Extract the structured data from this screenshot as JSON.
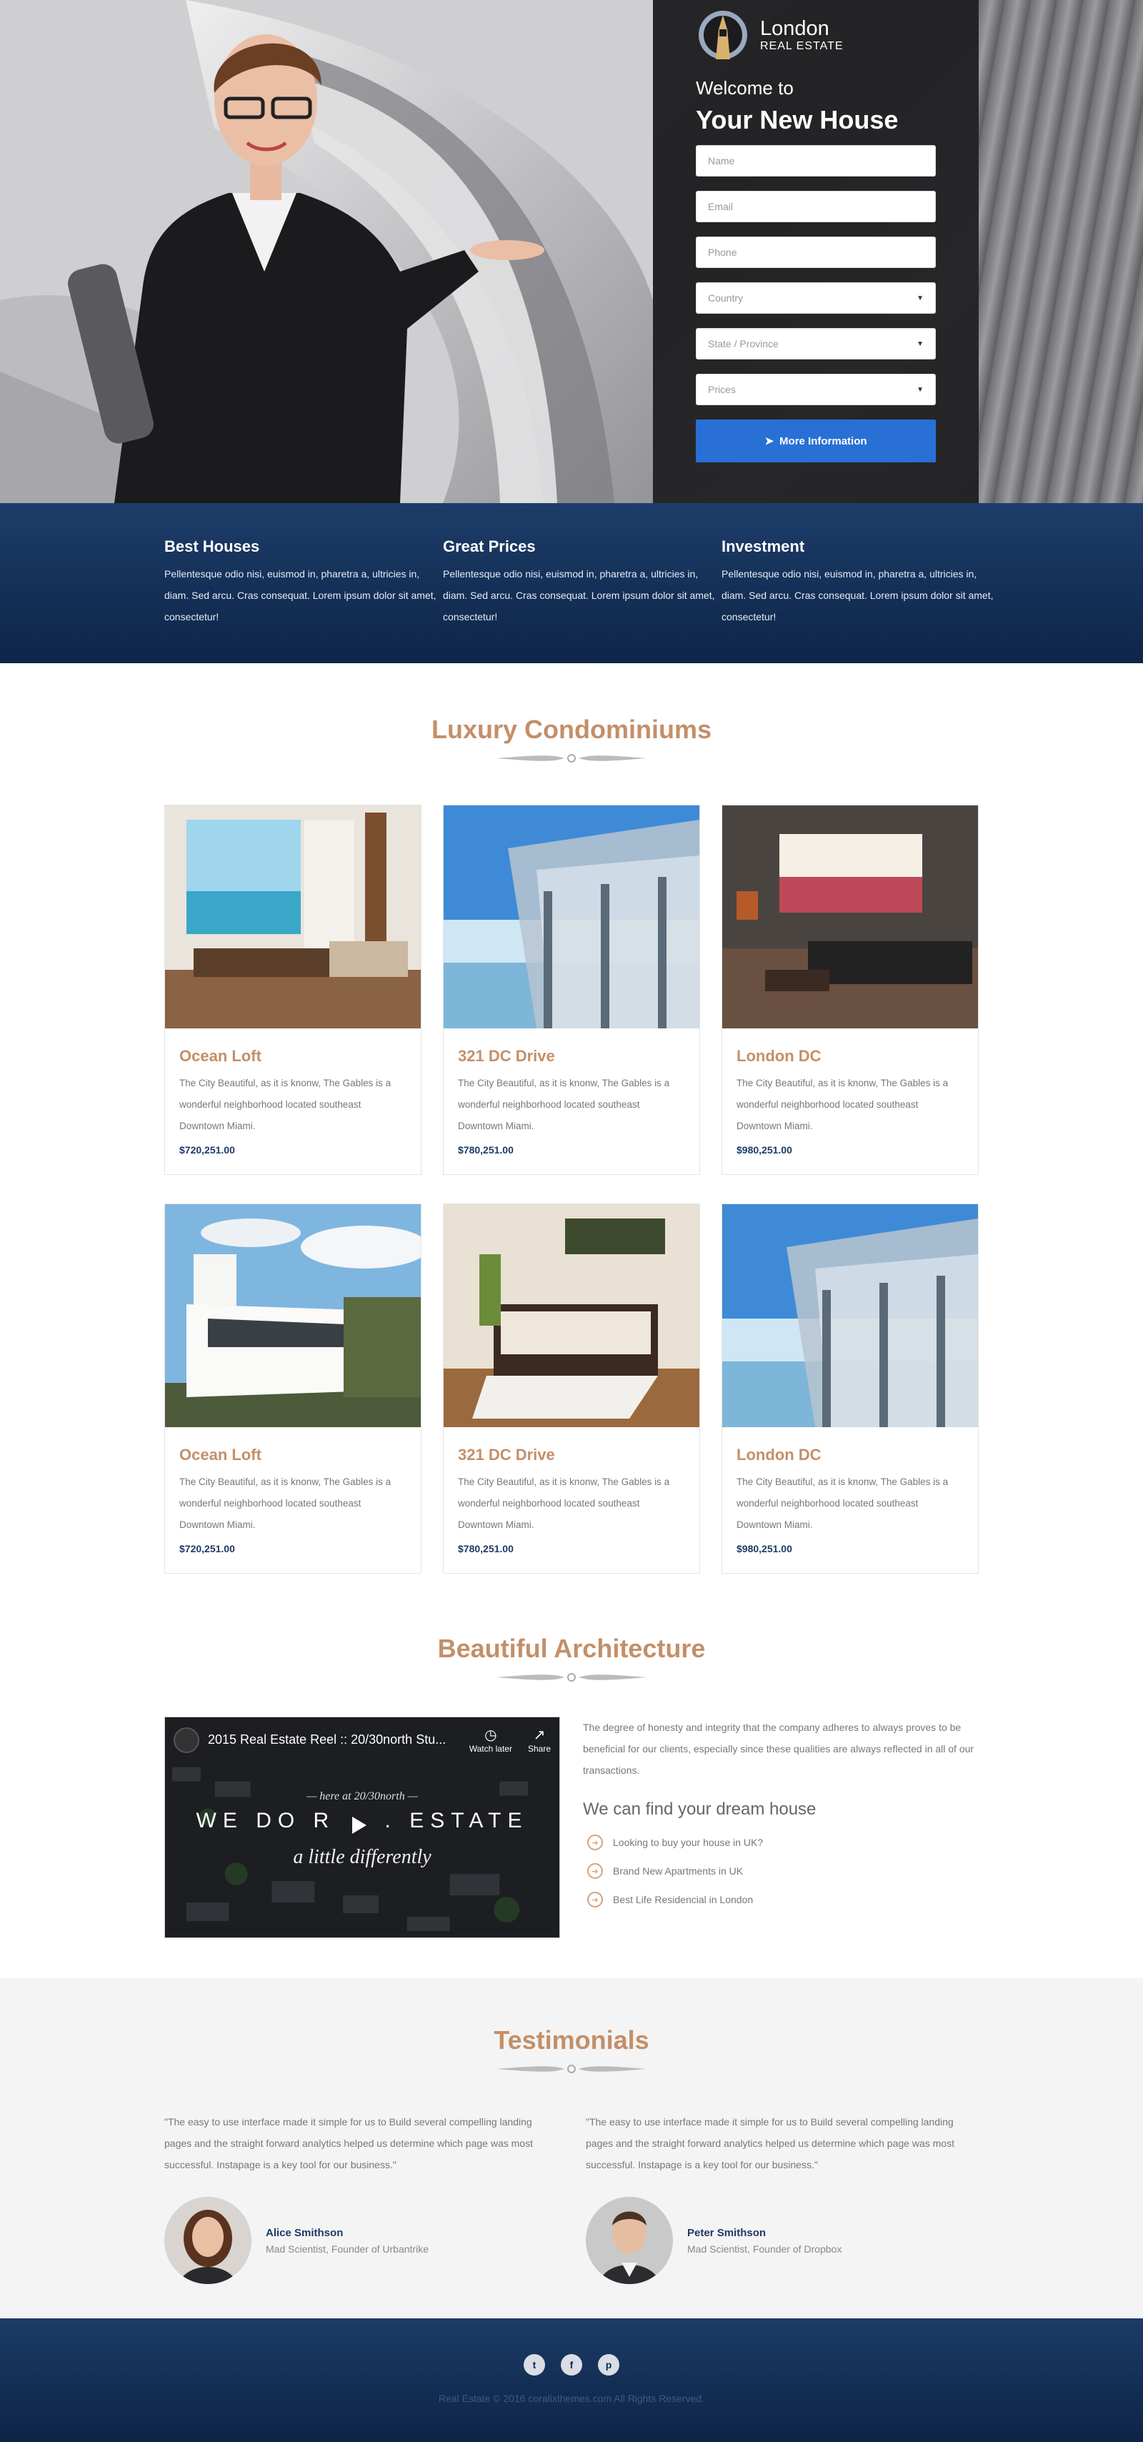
{
  "hero": {
    "brand_name": "London",
    "brand_sub": "REAL ESTATE",
    "welcome": "Welcome to",
    "headline": "Your New House",
    "form": {
      "name_placeholder": "Name",
      "email_placeholder": "Email",
      "phone_placeholder": "Phone",
      "country": "Country",
      "state": "State / Province",
      "prices": "Prices",
      "submit_label": "More Information"
    }
  },
  "features": [
    {
      "title": "Best Houses",
      "text": "Pellentesque odio nisi, euismod in, pharetra a, ultricies in, diam. Sed arcu. Cras consequat. Lorem ipsum dolor sit amet, consectetur!"
    },
    {
      "title": "Great Prices",
      "text": "Pellentesque odio nisi, euismod in, pharetra a, ultricies in, diam. Sed arcu. Cras consequat. Lorem ipsum dolor sit amet, consectetur!"
    },
    {
      "title": "Investment",
      "text": "Pellentesque odio nisi, euismod in, pharetra a, ultricies in, diam. Sed arcu. Cras consequat. Lorem ipsum dolor sit amet, consectetur!"
    }
  ],
  "listings": {
    "title": "Luxury Condominiums",
    "cards": [
      {
        "title": "Ocean Loft",
        "desc": "The City Beautiful, as it is knonw, The Gables is a wonderful neighborhood located southeast Downtown Miami.",
        "price": "$720,251.00"
      },
      {
        "title": "321 DC Drive",
        "desc": "The City Beautiful, as it is knonw, The Gables is a wonderful neighborhood located southeast Downtown Miami.",
        "price": "$780,251.00"
      },
      {
        "title": "London DC",
        "desc": "The City Beautiful, as it is knonw, The Gables is a wonderful neighborhood located southeast Downtown Miami.",
        "price": "$980,251.00"
      },
      {
        "title": "Ocean Loft",
        "desc": "The City Beautiful, as it is knonw, The Gables is a wonderful neighborhood located southeast Downtown Miami.",
        "price": "$720,251.00"
      },
      {
        "title": "321 DC Drive",
        "desc": "The City Beautiful, as it is knonw, The Gables is a wonderful neighborhood located southeast Downtown Miami.",
        "price": "$780,251.00"
      },
      {
        "title": "London DC",
        "desc": "The City Beautiful, as it is knonw, The Gables is a wonderful neighborhood located southeast Downtown Miami.",
        "price": "$980,251.00"
      }
    ]
  },
  "architecture": {
    "title": "Beautiful Architecture",
    "video": {
      "title": "2015 Real Estate Reel :: 20/30north Stu...",
      "watch_later": "Watch later",
      "share": "Share",
      "line_small": "— here at 20/30north —",
      "line_big": "WE DO R",
      "line_big_end": ". ESTATE",
      "line_italic": "a little differently"
    },
    "paragraph": "The degree of honesty and integrity that the company adheres to always proves to be beneficial for our clients, especially since these qualities are always reflected in all of our transactions.",
    "subtitle": "We can find your dream house",
    "bullets": [
      "Looking to buy your house in UK?",
      "Brand New Apartments in UK",
      "Best Life Residencial in London"
    ]
  },
  "testimonials": {
    "title": "Testimonials",
    "items": [
      {
        "quote": "\"The easy to use interface made it simple for us to Build several compelling landing pages and the straight forward analytics helped us determine which page was most successful. Instapage is a key tool for our business.\"",
        "name": "Alice Smithson",
        "role": "Mad Scientist, Founder of Urbantrike"
      },
      {
        "quote": "\"The easy to use interface made it simple for us to Build several compelling landing pages and the straight forward analytics helped us determine which page was most successful. Instapage is a key tool for our business.\"",
        "name": "Peter Smithson",
        "role": "Mad Scientist, Founder of Dropbox"
      }
    ]
  },
  "footer": {
    "copyright": "Real Estate © 2016 coralixthemes.com All Rights Reserved.",
    "social": [
      "twitter-icon",
      "facebook-icon",
      "pinterest-icon"
    ]
  },
  "colors": {
    "accent": "#c48f68",
    "navy": "#0e2548",
    "button": "#2870d6"
  }
}
